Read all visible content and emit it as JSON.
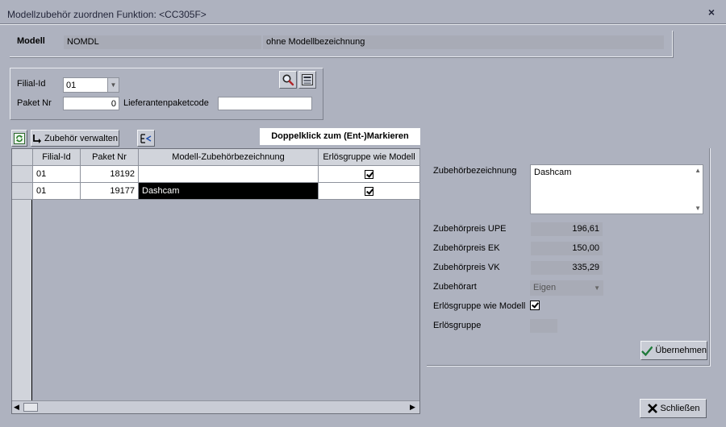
{
  "window": {
    "title": "Modellzubehör zuordnen   Funktion: <CC305F>",
    "close_label": "×"
  },
  "model": {
    "label": "Modell",
    "code": "NOMDL",
    "description": "ohne Modellbezeichnung"
  },
  "filter": {
    "filial_label": "Filial-Id",
    "filial_value": "01",
    "paket_label": "Paket Nr",
    "paket_value": "0",
    "lieferant_label": "Lieferantenpaketcode",
    "lieferant_value": ""
  },
  "toolbar": {
    "manage_label": "Zubehör verwalten",
    "hint": "Doppelklick zum (Ent-)Markieren"
  },
  "grid": {
    "headers": [
      "Filial-Id",
      "Paket Nr",
      "Modell-Zubehörbezeichnung",
      "Erlösgruppe wie Modell"
    ],
    "rows": [
      {
        "filial": "01",
        "paket": "18192",
        "bezeichnung": "",
        "erloes_wie_modell": true
      },
      {
        "filial": "01",
        "paket": "19177",
        "bezeichnung": "Dashcam",
        "erloes_wie_modell": true
      }
    ]
  },
  "details": {
    "bezeichnung_label": "Zubehörbezeichnung",
    "bezeichnung_value": "Dashcam",
    "upe_label": "Zubehörpreis UPE",
    "upe_value": "196,61",
    "ek_label": "Zubehörpreis EK",
    "ek_value": "150,00",
    "vk_label": "Zubehörpreis VK",
    "vk_value": "335,29",
    "art_label": "Zubehörart",
    "art_value": "Eigen",
    "erloes_wie_label": "Erlösgruppe wie Modell",
    "erloes_wie_checked": true,
    "erloesgruppe_label": "Erlösgruppe",
    "erloesgruppe_value": ""
  },
  "buttons": {
    "apply_label": "Übernehmen",
    "close_label": "Schließen"
  }
}
